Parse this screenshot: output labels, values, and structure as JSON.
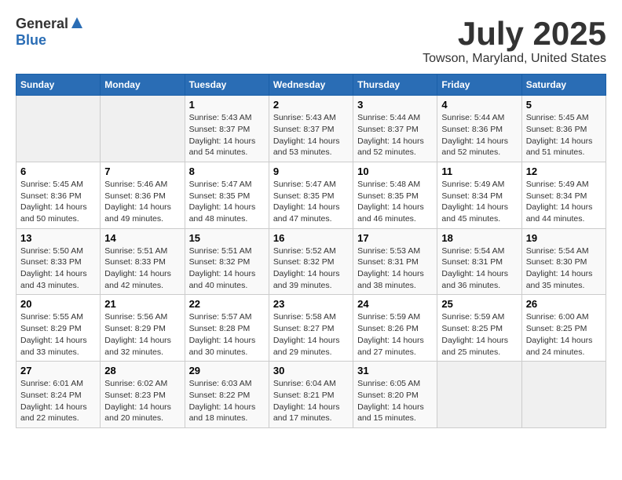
{
  "header": {
    "logo_general": "General",
    "logo_blue": "Blue",
    "title": "July 2025",
    "location": "Towson, Maryland, United States"
  },
  "days_of_week": [
    "Sunday",
    "Monday",
    "Tuesday",
    "Wednesday",
    "Thursday",
    "Friday",
    "Saturday"
  ],
  "weeks": [
    [
      {
        "day": "",
        "empty": true
      },
      {
        "day": "",
        "empty": true
      },
      {
        "day": "1",
        "sunrise": "5:43 AM",
        "sunset": "8:37 PM",
        "daylight": "14 hours and 54 minutes."
      },
      {
        "day": "2",
        "sunrise": "5:43 AM",
        "sunset": "8:37 PM",
        "daylight": "14 hours and 53 minutes."
      },
      {
        "day": "3",
        "sunrise": "5:44 AM",
        "sunset": "8:37 PM",
        "daylight": "14 hours and 52 minutes."
      },
      {
        "day": "4",
        "sunrise": "5:44 AM",
        "sunset": "8:36 PM",
        "daylight": "14 hours and 52 minutes."
      },
      {
        "day": "5",
        "sunrise": "5:45 AM",
        "sunset": "8:36 PM",
        "daylight": "14 hours and 51 minutes."
      }
    ],
    [
      {
        "day": "6",
        "sunrise": "5:45 AM",
        "sunset": "8:36 PM",
        "daylight": "14 hours and 50 minutes."
      },
      {
        "day": "7",
        "sunrise": "5:46 AM",
        "sunset": "8:36 PM",
        "daylight": "14 hours and 49 minutes."
      },
      {
        "day": "8",
        "sunrise": "5:47 AM",
        "sunset": "8:35 PM",
        "daylight": "14 hours and 48 minutes."
      },
      {
        "day": "9",
        "sunrise": "5:47 AM",
        "sunset": "8:35 PM",
        "daylight": "14 hours and 47 minutes."
      },
      {
        "day": "10",
        "sunrise": "5:48 AM",
        "sunset": "8:35 PM",
        "daylight": "14 hours and 46 minutes."
      },
      {
        "day": "11",
        "sunrise": "5:49 AM",
        "sunset": "8:34 PM",
        "daylight": "14 hours and 45 minutes."
      },
      {
        "day": "12",
        "sunrise": "5:49 AM",
        "sunset": "8:34 PM",
        "daylight": "14 hours and 44 minutes."
      }
    ],
    [
      {
        "day": "13",
        "sunrise": "5:50 AM",
        "sunset": "8:33 PM",
        "daylight": "14 hours and 43 minutes."
      },
      {
        "day": "14",
        "sunrise": "5:51 AM",
        "sunset": "8:33 PM",
        "daylight": "14 hours and 42 minutes."
      },
      {
        "day": "15",
        "sunrise": "5:51 AM",
        "sunset": "8:32 PM",
        "daylight": "14 hours and 40 minutes."
      },
      {
        "day": "16",
        "sunrise": "5:52 AM",
        "sunset": "8:32 PM",
        "daylight": "14 hours and 39 minutes."
      },
      {
        "day": "17",
        "sunrise": "5:53 AM",
        "sunset": "8:31 PM",
        "daylight": "14 hours and 38 minutes."
      },
      {
        "day": "18",
        "sunrise": "5:54 AM",
        "sunset": "8:31 PM",
        "daylight": "14 hours and 36 minutes."
      },
      {
        "day": "19",
        "sunrise": "5:54 AM",
        "sunset": "8:30 PM",
        "daylight": "14 hours and 35 minutes."
      }
    ],
    [
      {
        "day": "20",
        "sunrise": "5:55 AM",
        "sunset": "8:29 PM",
        "daylight": "14 hours and 33 minutes."
      },
      {
        "day": "21",
        "sunrise": "5:56 AM",
        "sunset": "8:29 PM",
        "daylight": "14 hours and 32 minutes."
      },
      {
        "day": "22",
        "sunrise": "5:57 AM",
        "sunset": "8:28 PM",
        "daylight": "14 hours and 30 minutes."
      },
      {
        "day": "23",
        "sunrise": "5:58 AM",
        "sunset": "8:27 PM",
        "daylight": "14 hours and 29 minutes."
      },
      {
        "day": "24",
        "sunrise": "5:59 AM",
        "sunset": "8:26 PM",
        "daylight": "14 hours and 27 minutes."
      },
      {
        "day": "25",
        "sunrise": "5:59 AM",
        "sunset": "8:25 PM",
        "daylight": "14 hours and 25 minutes."
      },
      {
        "day": "26",
        "sunrise": "6:00 AM",
        "sunset": "8:25 PM",
        "daylight": "14 hours and 24 minutes."
      }
    ],
    [
      {
        "day": "27",
        "sunrise": "6:01 AM",
        "sunset": "8:24 PM",
        "daylight": "14 hours and 22 minutes."
      },
      {
        "day": "28",
        "sunrise": "6:02 AM",
        "sunset": "8:23 PM",
        "daylight": "14 hours and 20 minutes."
      },
      {
        "day": "29",
        "sunrise": "6:03 AM",
        "sunset": "8:22 PM",
        "daylight": "14 hours and 18 minutes."
      },
      {
        "day": "30",
        "sunrise": "6:04 AM",
        "sunset": "8:21 PM",
        "daylight": "14 hours and 17 minutes."
      },
      {
        "day": "31",
        "sunrise": "6:05 AM",
        "sunset": "8:20 PM",
        "daylight": "14 hours and 15 minutes."
      },
      {
        "day": "",
        "empty": true
      },
      {
        "day": "",
        "empty": true
      }
    ]
  ]
}
